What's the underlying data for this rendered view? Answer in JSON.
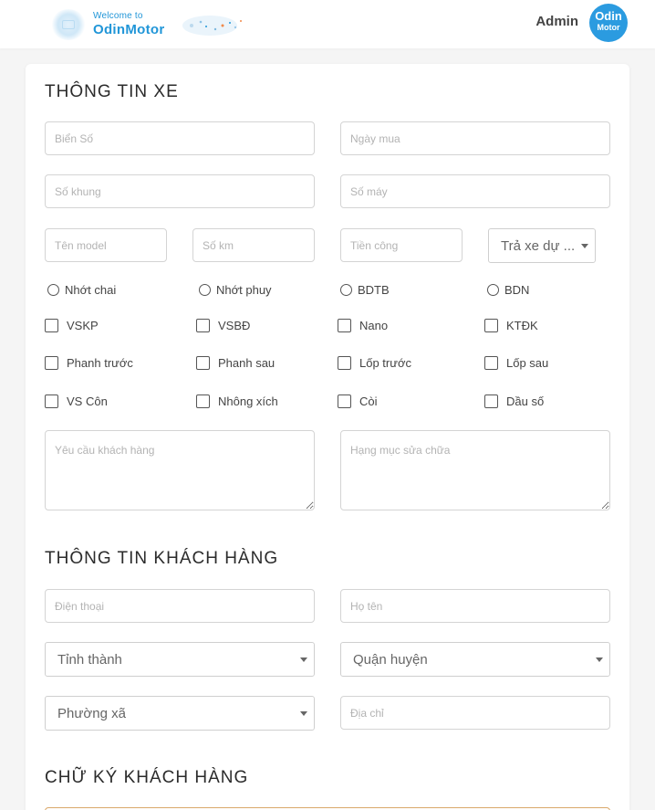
{
  "header": {
    "logo_small": "Welcome to",
    "logo_big": "OdinMotor",
    "user_name": "Admin",
    "avatar_line1": "Odin",
    "avatar_line2": "Motor",
    "brand_color": "#2196d8"
  },
  "vehicle": {
    "title": "THÔNG TIN XE",
    "plate_placeholder": "Biển Số",
    "buy_date_placeholder": "Ngày mua",
    "frame_placeholder": "Số khung",
    "engine_placeholder": "Số máy",
    "model_placeholder": "Tên model",
    "km_placeholder": "Số km",
    "labor_placeholder": "Tiền công",
    "return_select": "Trả xe dự ...",
    "radios": [
      "Nhớt chai",
      "Nhớt phuy",
      "BDTB",
      "BDN"
    ],
    "checks_row1": [
      "VSKP",
      "VSBĐ",
      "Nano",
      "KTĐK"
    ],
    "checks_row2": [
      "Phanh trước",
      "Phanh sau",
      "Lốp trước",
      "Lốp sau"
    ],
    "checks_row3": [
      "VS Côn",
      "Nhông xích",
      "Còi",
      "Dầu số"
    ],
    "request_placeholder": "Yêu cầu khách hàng",
    "repair_placeholder": "Hạng mục sửa chữa"
  },
  "customer": {
    "title": "THÔNG TIN KHÁCH HÀNG",
    "phone_placeholder": "Điện thoại",
    "name_placeholder": "Họ tên",
    "province_select": "Tỉnh thành",
    "district_select": "Quận huyện",
    "ward_select": "Phường xã",
    "address_placeholder": "Địa chỉ"
  },
  "signature": {
    "title": "CHỮ KÝ KHÁCH HÀNG"
  }
}
